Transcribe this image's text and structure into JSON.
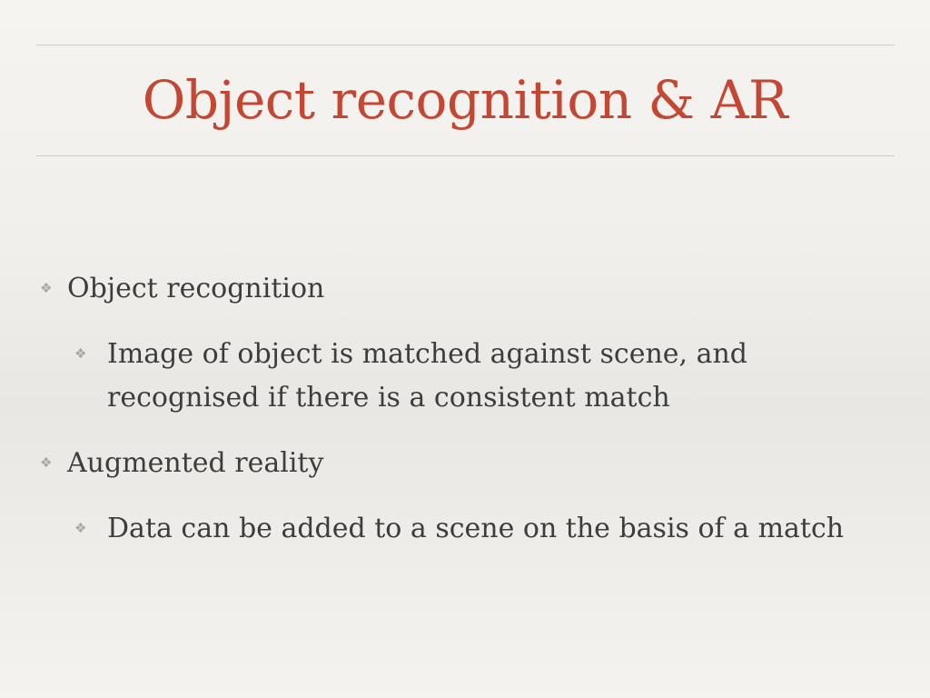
{
  "slide": {
    "title": "Object recognition & AR",
    "bullets": [
      {
        "text": "Object recognition",
        "children": [
          {
            "text": "Image of object is matched against scene, and recognised if there is a consistent match"
          }
        ]
      },
      {
        "text": "Augmented reality",
        "children": [
          {
            "text": "Data can be added to a scene on the basis of a match"
          }
        ]
      }
    ],
    "bullet_glyph": "❖"
  },
  "colors": {
    "title": "#c44734",
    "body_text": "#3d3d3d",
    "bullet": "#a9a7a3",
    "rule": "#cfcdc9"
  }
}
